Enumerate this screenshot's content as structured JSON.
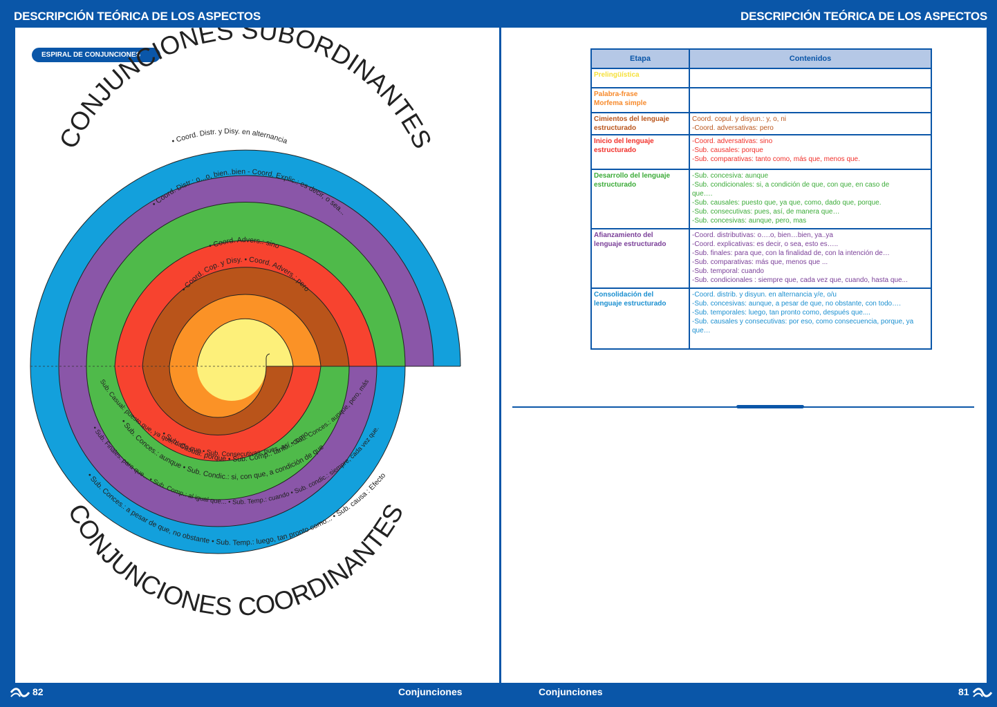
{
  "header": {
    "left_title": "DESCRIPCIÓN TEÓRICA DE LOS ASPECTOS",
    "right_title": "DESCRIPCIÓN TEÓRICA DE LOS ASPECTOS"
  },
  "footer": {
    "left_page": "82",
    "left_label": "Conjunciones",
    "right_label": "Conjunciones",
    "right_page": "81"
  },
  "section_pill": "ESPIRAL DE CONJUNCIONES",
  "spiral": {
    "title_top": "CONJUNCIONES SUBORDINANTES",
    "title_bottom": "CONJUNCIONES COORDINANTES",
    "colors": {
      "yellow": "#fdf07a",
      "orange": "#fb9226",
      "brown": "#b9541a",
      "red": "#f7432f",
      "green": "#4fba4a",
      "purple": "#8a56a8",
      "blue": "#13a0dc"
    },
    "upper_labels": [
      "• Coord. Distr. y Disy. en alternancia",
      "• Coord. Distr.: o...o, bien..bien - Coord. Explic.: es decir, o sea...",
      "• Coord. Advers.: sino",
      "• Coord. Cop. y Disy. • Coord. Advers.: pero"
    ],
    "lower_labels": [
      "• Sub. Casual: porque • Sub. Comp.: tanto...como",
      "• Sub. Conces.: aunque • Sub. Condic.: si, con que, a condición de que",
      "Sub. Casual: puesto que, ya que, dado que • Sub. Consecutivas: pues, así • Sub. Conces.: aunque, pero, más",
      "• Sub. Finales: para que... • Sub. Comp.: al igual que... • Sub. Temp.: cuando • Sub. condic.: siempre, cada vez que.",
      "• Sub. Conces.: a pesar de que, no obstante • Sub. Temp.: luego, tan pronto como... • Sub. causa : Efecto"
    ]
  },
  "table": {
    "headers": [
      "Etapa",
      "Contenidos"
    ],
    "rows": [
      {
        "stage": [
          "Prelingüística"
        ],
        "color": "#f5e03a",
        "contents": []
      },
      {
        "stage": [
          "Palabra-frase",
          "Morfema simple"
        ],
        "color": "#f7892a",
        "contents": []
      },
      {
        "stage": [
          "Cimientos del lenguaje",
          "estructurado"
        ],
        "color": "#b9541a",
        "contents": [
          "Coord. copul. y disyun.: y, o, ni",
          "-Coord. adversativas: pero"
        ]
      },
      {
        "stage": [
          "Inicio del lenguaje",
          "estructurado"
        ],
        "color": "#f1302a",
        "contents": [
          "-Coord. adversativas: sino",
          "-Sub. causales: porque",
          "-Sub. comparativas: tanto como, más que, menos que."
        ]
      },
      {
        "stage": [
          "Desarrollo del lenguaje",
          "estructurado"
        ],
        "color": "#3bab38",
        "contents": [
          "-Sub. concesiva: aunque",
          "-Sub. condicionales: si, a condición de que, con que, en caso de",
          "que….",
          "-Sub. causales: puesto que, ya que, como, dado que, porque.",
          "-Sub. consecutivas: pues, así, de manera que…",
          "-Sub. concesivas: aunque, pero, mas"
        ]
      },
      {
        "stage": [
          "Afianzamiento del",
          "lenguaje estructurado"
        ],
        "color": "#7a3f98",
        "contents": [
          "-Coord. distributivas: o….o, bien…bien, ya..ya",
          "-Coord. explicativas: es decir, o sea, esto es…..",
          "-Sub. finales: para que, con la finalidad de, con la intención de…",
          "-Sub. comparativas: más que, menos que ...",
          "-Sub. temporal: cuando",
          "-Sub. condicionales : siempre que, cada vez que, cuando, hasta que..."
        ]
      },
      {
        "stage": [
          "Consolidación del",
          "lenguaje estructurado"
        ],
        "color": "#1a8fd0",
        "contents": [
          "-Coord. distrib. y disyun. en alternancia y/e, o/u",
          "-Sub. concesivas: aunque, a pesar de que, no obstante, con todo….",
          "-Sub. temporales: luego, tan pronto como, después que....",
          "-Sub. causales y consecutivas: por eso, como consecuencia, porque, ya",
          "que…"
        ]
      }
    ]
  }
}
